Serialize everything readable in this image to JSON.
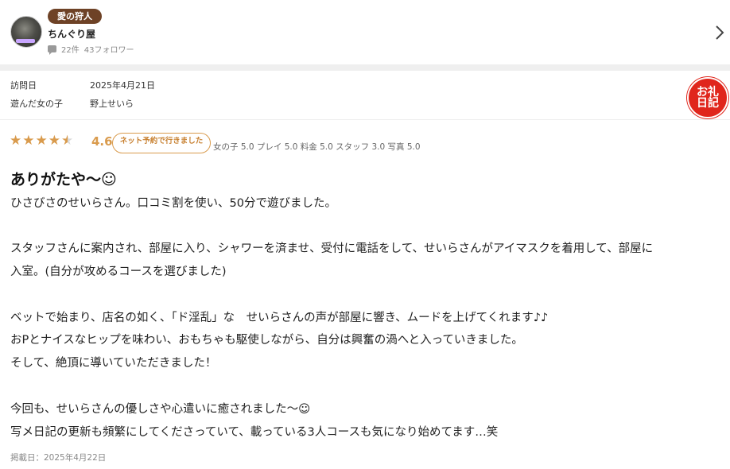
{
  "header": {
    "rank_badge": "愛の狩人",
    "username": "ちんぐり屋",
    "post_count": "22件",
    "followers": "43フォロワー"
  },
  "info": {
    "visit_label": "訪問日",
    "visit_value": "2025年4月21日",
    "girl_label": "遊んだ女の子",
    "girl_value": "野上せいら",
    "stamp_text": "お礼日記"
  },
  "rating": {
    "score": "4.6",
    "stars": 4.6,
    "net_badge": "ネット予約で行きました",
    "subratings": "女の子 5.0 プレイ 5.0 料金 5.0 スタッフ 3.0 写真 5.0"
  },
  "review": {
    "title": "ありがたや〜☺",
    "lines": [
      "ひさびさのせいらさん。口コミ割を使い、50分で遊びました。",
      "スタッフさんに案内され、部屋に入り、シャワーを済ませ、受付に電話をして、せいらさんがアイマスクを着用して、部屋に",
      "入室。(自分が攻めるコースを選びました)",
      "ベットで始まり、店名の如く、「ド淫乱」な　せいらさんの声が部屋に響き、ムードを上げてくれます♪♪",
      "おPとナイスなヒップを味わい、おもちゃも駆使しながら、自分は興奮の渦へと入っていきました。",
      "そして、絶頂に導いていただきました！",
      "今回も、せいらさんの優しさや心遣いに癒されました〜☺",
      "写メ日記の更新も頻繁にしてくださっていて、載っている3人コースも気になり始めてます…笑"
    ],
    "posted": "掲載日：2025年4月22日"
  },
  "colors": {
    "accent": "#d99b4d",
    "badge_brown": "#6e4226",
    "stamp_red": "#e0261c"
  }
}
